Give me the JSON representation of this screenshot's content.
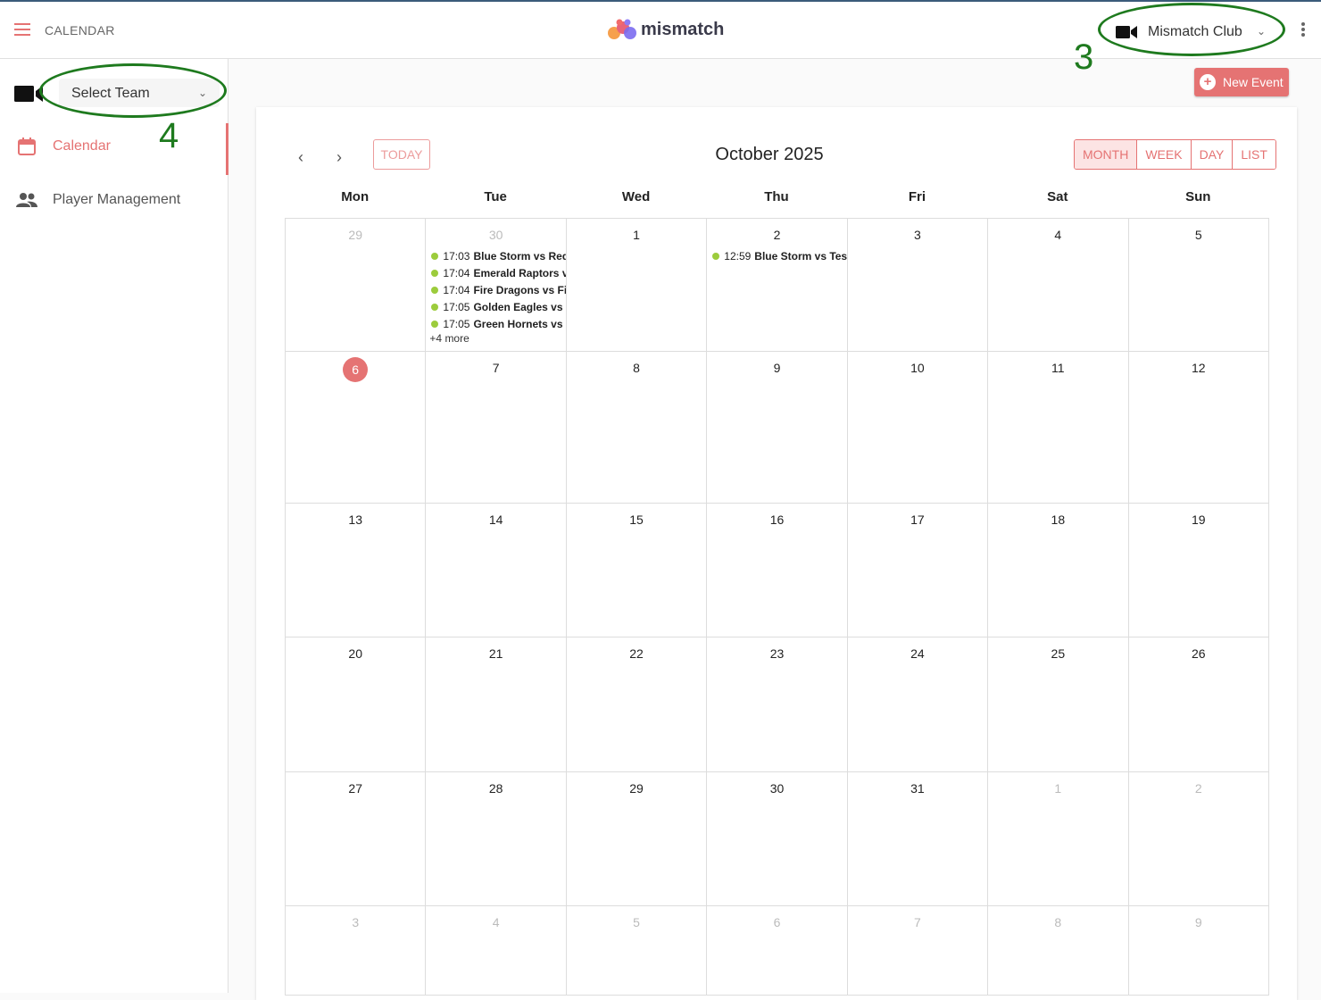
{
  "header": {
    "page_title": "CALENDAR",
    "logo_text": "mismatch",
    "club": "Mismatch Club"
  },
  "sidebar": {
    "team_placeholder": "Select Team",
    "items": [
      {
        "label": "Calendar",
        "icon": "calendar-icon",
        "active": true
      },
      {
        "label": "Player Management",
        "icon": "people-icon",
        "active": false
      }
    ]
  },
  "annotations": {
    "club_marker": "3",
    "team_marker": "4"
  },
  "toolbar": {
    "new_event": "New Event",
    "today": "TODAY",
    "month_title": "October 2025",
    "views": [
      "MONTH",
      "WEEK",
      "DAY",
      "LIST"
    ],
    "active_view": "MONTH"
  },
  "calendar": {
    "days_of_week": [
      "Mon",
      "Tue",
      "Wed",
      "Thu",
      "Fri",
      "Sat",
      "Sun"
    ],
    "weeks": [
      [
        {
          "n": "29",
          "other": true,
          "events": []
        },
        {
          "n": "30",
          "other": true,
          "events": [
            {
              "time": "17:03",
              "title": "Blue Storm vs Red S"
            },
            {
              "time": "17:04",
              "title": "Emerald Raptors vs"
            },
            {
              "time": "17:04",
              "title": "Fire Dragons vs Fire"
            },
            {
              "time": "17:05",
              "title": "Golden Eagles vs Go"
            },
            {
              "time": "17:05",
              "title": "Green Hornets vs Gr"
            }
          ],
          "more": "+4 more"
        },
        {
          "n": "1",
          "events": []
        },
        {
          "n": "2",
          "events": [
            {
              "time": "12:59",
              "title": "Blue Storm vs Test"
            }
          ]
        },
        {
          "n": "3",
          "events": []
        },
        {
          "n": "4",
          "events": []
        },
        {
          "n": "5",
          "events": []
        }
      ],
      [
        {
          "n": "6",
          "today": true,
          "events": []
        },
        {
          "n": "7",
          "events": []
        },
        {
          "n": "8",
          "events": []
        },
        {
          "n": "9",
          "events": []
        },
        {
          "n": "10",
          "events": []
        },
        {
          "n": "11",
          "events": []
        },
        {
          "n": "12",
          "events": []
        }
      ],
      [
        {
          "n": "13",
          "events": []
        },
        {
          "n": "14",
          "events": []
        },
        {
          "n": "15",
          "events": []
        },
        {
          "n": "16",
          "events": []
        },
        {
          "n": "17",
          "events": []
        },
        {
          "n": "18",
          "events": []
        },
        {
          "n": "19",
          "events": []
        }
      ],
      [
        {
          "n": "20",
          "events": []
        },
        {
          "n": "21",
          "events": []
        },
        {
          "n": "22",
          "events": []
        },
        {
          "n": "23",
          "events": []
        },
        {
          "n": "24",
          "events": []
        },
        {
          "n": "25",
          "events": []
        },
        {
          "n": "26",
          "events": []
        }
      ],
      [
        {
          "n": "27",
          "events": []
        },
        {
          "n": "28",
          "events": []
        },
        {
          "n": "29",
          "events": []
        },
        {
          "n": "30",
          "events": []
        },
        {
          "n": "31",
          "events": []
        },
        {
          "n": "1",
          "other": true,
          "events": []
        },
        {
          "n": "2",
          "other": true,
          "events": []
        }
      ],
      [
        {
          "n": "3",
          "other": true,
          "events": []
        },
        {
          "n": "4",
          "other": true,
          "events": []
        },
        {
          "n": "5",
          "other": true,
          "events": []
        },
        {
          "n": "6",
          "other": true,
          "events": []
        },
        {
          "n": "7",
          "other": true,
          "events": []
        },
        {
          "n": "8",
          "other": true,
          "events": []
        },
        {
          "n": "9",
          "other": true,
          "events": []
        }
      ]
    ]
  },
  "colors": {
    "accent": "#e57373",
    "event_dot": "#9ccc3c",
    "annotation": "#1e7a1e"
  }
}
